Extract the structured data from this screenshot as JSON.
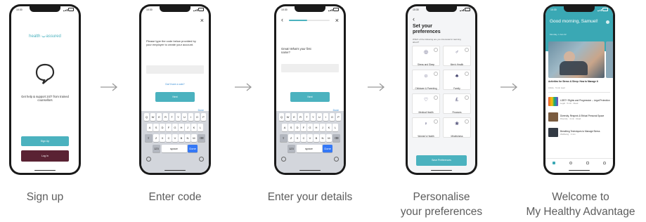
{
  "steps": [
    {
      "caption": "Sign up"
    },
    {
      "caption": "Enter code"
    },
    {
      "caption": "Enter your details"
    },
    {
      "caption_line1": "Personalise",
      "caption_line2": "your preferences"
    },
    {
      "caption_line1": "Welcome to",
      "caption_line2": "My Healthy Advantage"
    }
  ],
  "status_time": "10:30",
  "colors": {
    "teal": "#4bb2bf",
    "maroon": "#5a2233",
    "caption": "#5d5d5d",
    "arrow": "#9a9a9a"
  },
  "phone1": {
    "logo_left": "health",
    "logo_right": "assured",
    "tagline": "Get help & support 24/7 from trained counsellors",
    "signup_button": "Sign Up",
    "login_button": "Log In"
  },
  "phone2": {
    "close_icon": "×",
    "instruction": "Please type the code below provided by your employer to create your account.",
    "input_value": "",
    "link_text": "Don't have a code?",
    "next_button": "Next",
    "done_label": "Done"
  },
  "phone3": {
    "back_icon": "‹",
    "close_icon": "×",
    "prompt": "Great! What's your first name?",
    "input_value": "",
    "next_button": "Next",
    "done_label": "Done"
  },
  "keyboard": {
    "row1": [
      "Q",
      "W",
      "E",
      "R",
      "T",
      "Y",
      "U",
      "I",
      "O",
      "P"
    ],
    "row2": [
      "A",
      "S",
      "D",
      "F",
      "G",
      "H",
      "J",
      "K",
      "L"
    ],
    "row3": [
      "Z",
      "X",
      "C",
      "V",
      "B",
      "N",
      "M"
    ],
    "num_key": "123",
    "space_key": "space",
    "go_key": "Done"
  },
  "phone4": {
    "back_icon": "‹",
    "title": "Set your preferences",
    "subtitle": "Which of the following are you interested in learning about?",
    "tiles": [
      {
        "label": "Stress and Sleep",
        "icon": "◎"
      },
      {
        "label": "Men's Health",
        "icon": "♂"
      },
      {
        "label": "Childcare & Parenting",
        "icon": "☺"
      },
      {
        "label": "Family",
        "icon": "♣"
      },
      {
        "label": "Medical Health",
        "icon": "♡"
      },
      {
        "label": "Finances",
        "icon": "£"
      },
      {
        "label": "Women's Health",
        "icon": "♀"
      },
      {
        "label": "Mindfulness",
        "icon": "❀"
      }
    ],
    "save_button": "Save Preferences"
  },
  "phone5": {
    "greeting": "Good morning, Samuel!",
    "date": "Monday, 1 Jan 22",
    "featured_title": "Activities for Stress & Sleep: How to Manage It",
    "featured_meta": "Article · 5 min read",
    "section_label": "LGBT+ Rights and Progression",
    "feed": [
      {
        "title": "LGBT+ Rights and Progression – Legal Protection",
        "meta": "Legal · 5 min · Read",
        "color": "#e3a43a"
      },
      {
        "title": "Diversity, Respect & Ethical Personal Space",
        "meta": "Diversity · 4 min · Read",
        "color": "#7a5b3f"
      },
      {
        "title": "Breathing Techniques to Manage Stress",
        "meta": "Wellbeing · 3 min",
        "color": "#333a44"
      }
    ],
    "nav_icons": [
      "home-icon",
      "search-icon",
      "heart-icon",
      "profile-icon"
    ]
  }
}
